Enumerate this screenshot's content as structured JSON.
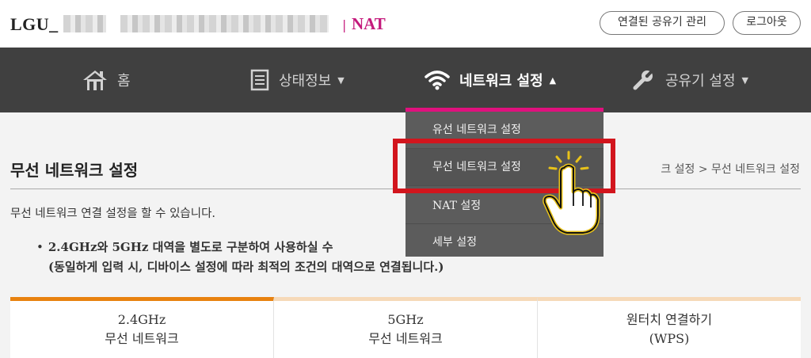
{
  "header": {
    "brand": "LGU_",
    "separator": "|",
    "mode": "NAT",
    "connected_routers_label": "연결된 공유기 관리",
    "logout_label": "로그아웃"
  },
  "nav": {
    "home": "홈",
    "status": "상태정보",
    "network": "네트워크 설정",
    "router": "공유기 설정",
    "icons": {
      "home": "home-icon",
      "status": "document-icon",
      "network": "wifi-icon",
      "router": "wrench-icon"
    }
  },
  "dropdown": {
    "items": [
      "유선 네트워크 설정",
      "무선 네트워크 설정",
      "NAT 설정",
      "세부 설정"
    ]
  },
  "page": {
    "title": "무선 네트워크 설정",
    "breadcrumb": "크 설정 > 무선 네트워크 설정",
    "intro": "무선 네트워크 연결 설정을 할 수 있습니다.",
    "note_bullet": "•",
    "note_line1": "2.4GHz와 5GHz 대역을 별도로 구분하여 사용하실 수",
    "note_line2": "(동일하게 입력 시, 디바이스 설정에 따라 최적의 조건의 대역으로 연결됩니다.)"
  },
  "tabs": [
    {
      "line1": "2.4GHz",
      "line2": "무선 네트워크"
    },
    {
      "line1": "5GHz",
      "line2": "무선 네트워크"
    },
    {
      "line1": "원터치 연결하기",
      "line2": "(WPS)"
    }
  ],
  "colors": {
    "accent": "#c41a7c",
    "nav_bg": "#404040",
    "dropdown_accent": "#e0117e",
    "highlight": "#d2151d",
    "tab_active": "#e8820f"
  }
}
